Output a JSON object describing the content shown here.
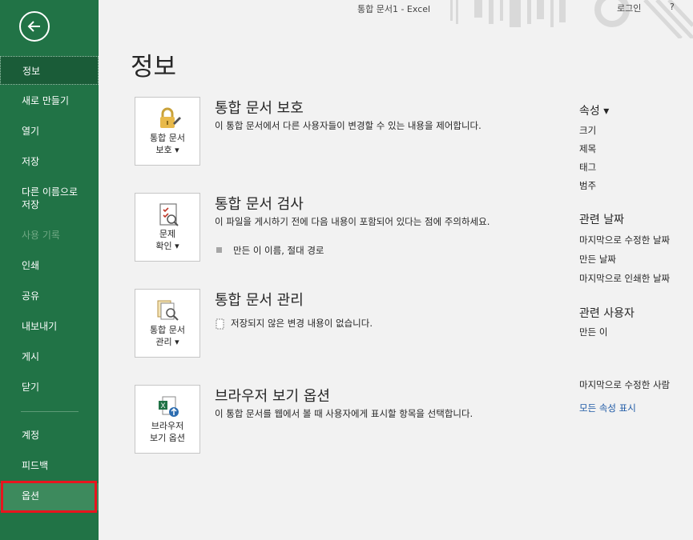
{
  "window": {
    "title": "통합 문서1  -  Excel",
    "login": "로그인",
    "help": "?"
  },
  "sidebar": {
    "items": [
      {
        "label": "정보"
      },
      {
        "label": "새로 만들기"
      },
      {
        "label": "열기"
      },
      {
        "label": "저장"
      },
      {
        "label": "다른 이름으로\n저장"
      },
      {
        "label": "사용 기록"
      },
      {
        "label": "인쇄"
      },
      {
        "label": "공유"
      },
      {
        "label": "내보내기"
      },
      {
        "label": "게시"
      },
      {
        "label": "닫기"
      },
      {
        "label": "계정"
      },
      {
        "label": "피드백"
      },
      {
        "label": "옵션"
      }
    ]
  },
  "page": {
    "title": "정보"
  },
  "sections": {
    "protect": {
      "title": "통합 문서 보호",
      "desc": "이 통합 문서에서 다른 사용자들이 변경할 수 있는 내용을 제어합니다.",
      "tile": "통합 문서\n보호 ▾",
      "icon": "lock-icon"
    },
    "inspect": {
      "title": "통합 문서 검사",
      "desc": "이 파일을 게시하기 전에 다음 내용이 포함되어 있다는 점에 주의하세요.",
      "bullet": "만든 이 이름, 절대 경로",
      "tile": "문제\n확인 ▾",
      "icon": "check-document-icon"
    },
    "manage": {
      "title": "통합 문서 관리",
      "bullet": "저장되지 않은 변경 내용이 없습니다.",
      "tile": "통합 문서\n관리 ▾",
      "icon": "manage-document-icon"
    },
    "browser": {
      "title": "브라우저 보기 옵션",
      "desc": "이 통합 문서를 웹에서 볼 때 사용자에게 표시할 항목을 선택합니다.",
      "tile": "브라우저\n보기 옵션",
      "icon": "excel-upload-icon"
    }
  },
  "properties": {
    "heading": "속성 ▾",
    "items": [
      "크기",
      "제목",
      "태그",
      "범주"
    ],
    "dates_heading": "관련 날짜",
    "dates": [
      "마지막으로 수정한 날짜",
      "만든 날짜",
      "마지막으로 인쇄한 날짜"
    ],
    "people_heading": "관련 사용자",
    "people": [
      "만든 이"
    ],
    "last_modified_by": "마지막으로 수정한 사람",
    "show_all": "모든 속성 표시"
  },
  "colors": {
    "sidebar": "#217346",
    "highlight": "#e8141e",
    "link": "#1f5aa6"
  }
}
